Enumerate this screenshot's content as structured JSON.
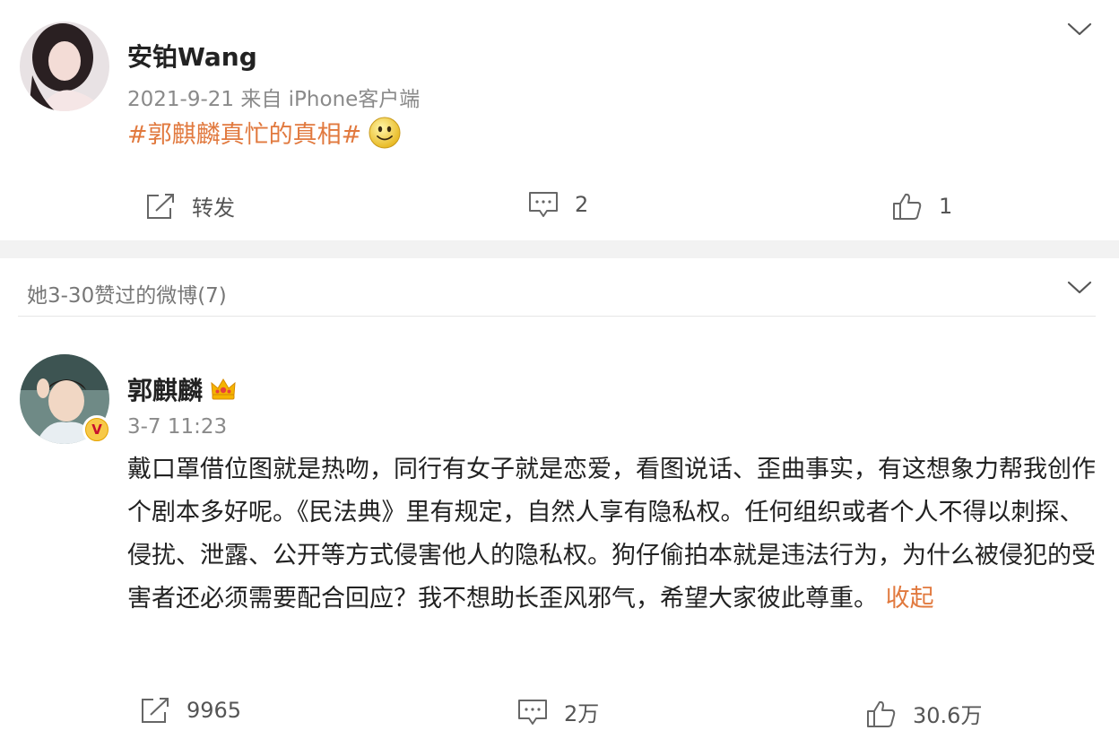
{
  "post1": {
    "author": "安铂Wang",
    "meta": "2021-9-21 来自 iPhone客户端",
    "topic": "#郭麒麟真忙的真相#",
    "actions": {
      "repost_label": "转发",
      "comments": "2",
      "likes": "1"
    }
  },
  "liked_header": "她3-30赞过的微博(7)",
  "post2": {
    "author": "郭麒麟",
    "meta": "3-7 11:23",
    "badge": "V",
    "text": "戴口罩借位图就是热吻，同行有女子就是恋爱，看图说话、歪曲事实，有这想象力帮我创作个剧本多好呢。《民法典》里有规定，自然人享有隐私权。任何组织或者个人不得以刺探、侵扰、泄露、公开等方式侵害他人的隐私权。狗仔偷拍本就是违法行为，为什么被侵犯的受害者还必须需要配合回应？我不想助长歪风邪气，希望大家彼此尊重。",
    "collapse": "收起",
    "actions": {
      "reposts": "9965",
      "comments": "2万",
      "likes": "30.6万"
    }
  },
  "colors": {
    "accent": "#e1793e",
    "separator": "#f2f2f2"
  },
  "icons": [
    "chevron-down-icon",
    "repost-icon",
    "comment-icon",
    "like-icon",
    "smile-emoji-icon",
    "crown-icon",
    "verified-badge-icon"
  ]
}
